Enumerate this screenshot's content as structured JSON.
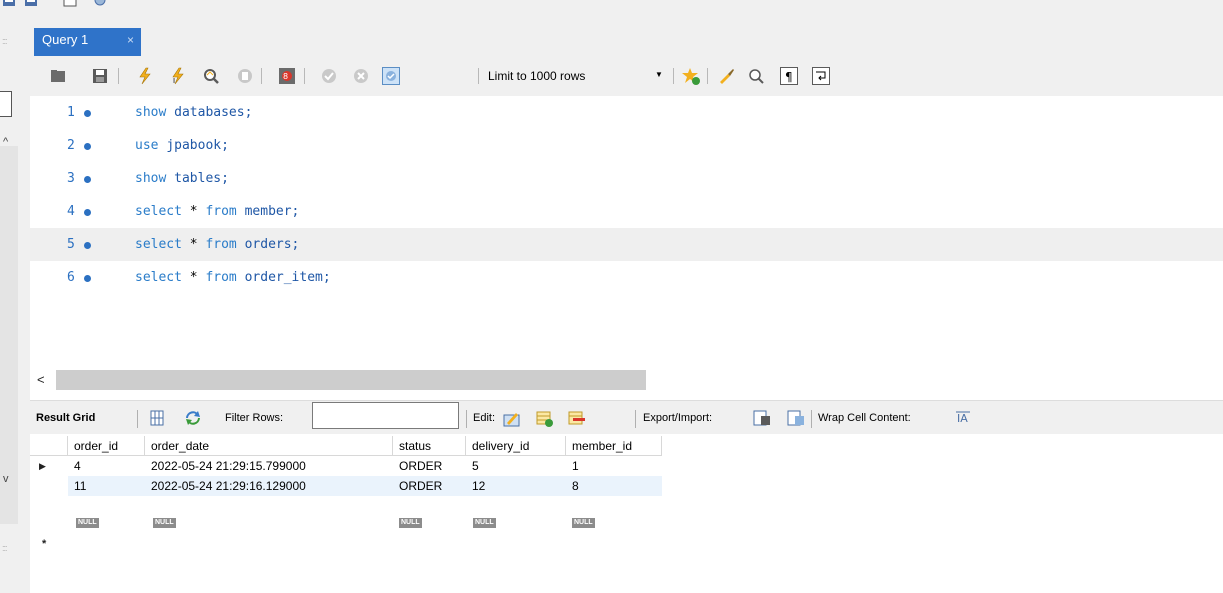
{
  "tab": {
    "title": "Query 1",
    "close_glyph": "×"
  },
  "toolbar": {
    "limit_label": "Limit to 1000 rows",
    "icons": [
      "open-folder-icon",
      "save-icon",
      "execute-icon",
      "execute-current-icon",
      "explain-icon",
      "stop-icon",
      "toggle-error-icon",
      "commit-icon",
      "rollback-icon",
      "autocommit-icon",
      "add-snippet-icon",
      "beautify-icon",
      "find-icon",
      "invisible-chars-icon",
      "wrap-icon"
    ]
  },
  "editor": {
    "lines": [
      {
        "num": "1",
        "code": "show databases;"
      },
      {
        "num": "2",
        "code": "use jpabook;"
      },
      {
        "num": "3",
        "code": "show tables;"
      },
      {
        "num": "4",
        "code": "select * from member;"
      },
      {
        "num": "5",
        "code": "select * from orders;"
      },
      {
        "num": "6",
        "code": "select * from order_item;"
      }
    ],
    "highlighted_line": 5
  },
  "result_bar": {
    "result_grid_label": "Result Grid",
    "filter_label": "Filter Rows:",
    "filter_value": "",
    "edit_label": "Edit:",
    "export_label": "Export/Import:",
    "wrap_label": "Wrap Cell Content:"
  },
  "grid": {
    "columns": [
      "order_id",
      "order_date",
      "status",
      "delivery_id",
      "member_id"
    ],
    "rows": [
      [
        "4",
        "2022-05-24 21:29:15.799000",
        "ORDER",
        "5",
        "1"
      ],
      [
        "11",
        "2022-05-24 21:29:16.129000",
        "ORDER",
        "12",
        "8"
      ]
    ],
    "null_label": "NULL",
    "new_row_marker": "*",
    "current_row_marker": "▶"
  },
  "colors": {
    "accent": "#2f73c9",
    "keyword": "#2a7cc9",
    "line_number": "#2b70c1",
    "alt_row": "#eaf3fc"
  }
}
